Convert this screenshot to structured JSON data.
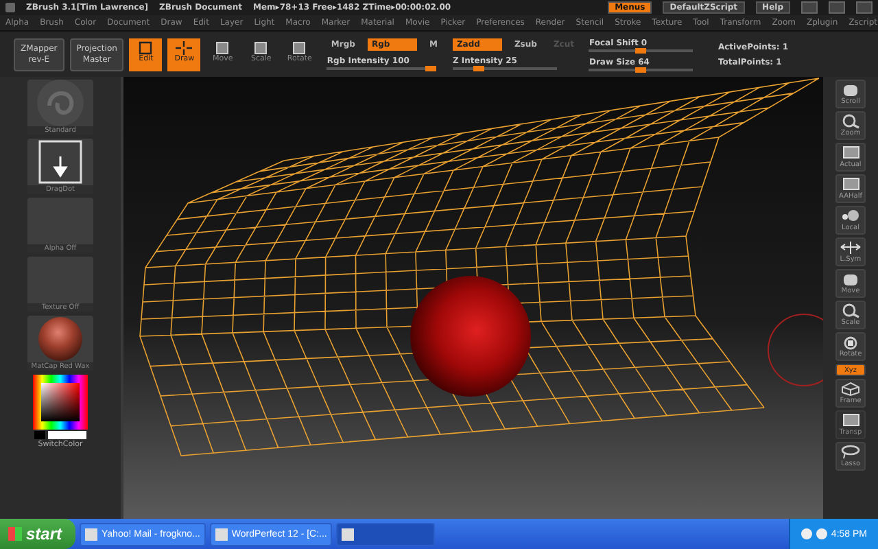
{
  "title_bar": {
    "app": "ZBrush 3.1[Tim Lawrence]",
    "document": "ZBrush Document",
    "stats": "Mem▸78+13 Free▸1482 ZTime▸00:00:02.00",
    "buttons": [
      {
        "label": "Menus",
        "selected": true
      },
      {
        "label": "DefaultZScript",
        "selected": false
      },
      {
        "label": "Help",
        "selected": false
      }
    ]
  },
  "menu": [
    "Alpha",
    "Brush",
    "Color",
    "Document",
    "Draw",
    "Edit",
    "Layer",
    "Light",
    "Macro",
    "Marker",
    "Material",
    "Movie",
    "Picker",
    "Preferences",
    "Render",
    "Stencil",
    "Stroke",
    "Texture",
    "Tool",
    "Transform",
    "Zoom",
    "Zplugin",
    "Zscript"
  ],
  "toolbar": {
    "plugins": [
      {
        "line1": "ZMapper",
        "line2": "rev-E"
      },
      {
        "line1": "Projection",
        "line2": "Master"
      }
    ],
    "modes": [
      {
        "label": "Edit",
        "kind": "edit",
        "selected": true
      },
      {
        "label": "Draw",
        "kind": "draw",
        "selected": true
      },
      {
        "label": "Move",
        "kind": "move",
        "selected": false
      },
      {
        "label": "Scale",
        "kind": "scale",
        "selected": false
      },
      {
        "label": "Rotate",
        "kind": "rotate",
        "selected": false
      }
    ],
    "color_modes": [
      {
        "label": "Mrgb",
        "selected": false
      },
      {
        "label": "Rgb",
        "selected": true
      },
      {
        "label": "M",
        "selected": false
      }
    ],
    "rgb_intensity": {
      "label": "Rgb Intensity 100",
      "level": 1
    },
    "depth_modes": [
      {
        "label": "Zadd",
        "selected": true,
        "disabled": false
      },
      {
        "label": "Zsub",
        "selected": false,
        "disabled": false
      },
      {
        "label": "Zcut",
        "selected": false,
        "disabled": true
      }
    ],
    "z_intensity": {
      "label": "Z Intensity 25",
      "level": 0.25
    },
    "focal_shift": {
      "label": "Focal Shift 0",
      "level": 0.5
    },
    "draw_size": {
      "label": "Draw Size 64",
      "level": 0.5
    },
    "stats": [
      "ActivePoints: 1",
      "TotalPoints: 1"
    ]
  },
  "left_shelf": {
    "items": [
      {
        "label": "Standard",
        "kind": "brush"
      },
      {
        "label": "DragDot",
        "kind": "stroke"
      },
      {
        "label": "Alpha Off",
        "kind": "empty"
      },
      {
        "label": "Texture Off",
        "kind": "empty"
      },
      {
        "label": "MatCap Red Wax",
        "kind": "material"
      }
    ],
    "color_label": "SwitchColor"
  },
  "right_shelf": [
    {
      "label": "Scroll",
      "kind": "hand",
      "selected": false,
      "disabled": false
    },
    {
      "label": "Zoom",
      "kind": "zoom",
      "selected": false,
      "disabled": false
    },
    {
      "label": "Actual",
      "kind": "frame",
      "selected": false,
      "disabled": false
    },
    {
      "label": "AAHalf",
      "kind": "frame",
      "selected": false,
      "disabled": false
    },
    {
      "label": "Local",
      "kind": "local",
      "selected": false,
      "disabled": false
    },
    {
      "label": "L.Sym",
      "kind": "sym",
      "selected": false,
      "disabled": false
    },
    {
      "label": "Move",
      "kind": "hand",
      "selected": false,
      "disabled": false
    },
    {
      "label": "Scale",
      "kind": "zoom",
      "selected": false,
      "disabled": false
    },
    {
      "label": "Rotate",
      "kind": "rotate",
      "selected": false,
      "disabled": false
    },
    {
      "label": "Xyz",
      "kind": "toggle",
      "selected": true,
      "disabled": false
    },
    {
      "label": "Frame",
      "kind": "cube",
      "selected": false,
      "disabled": false
    },
    {
      "label": "Transp",
      "kind": "frame",
      "selected": false,
      "disabled": true
    },
    {
      "label": "Lasso",
      "kind": "lasso",
      "selected": false,
      "disabled": false
    }
  ],
  "taskbar": {
    "start": "start",
    "tasks": [
      {
        "label": "Yahoo! Mail - frogkno...",
        "selected": false
      },
      {
        "label": "WordPerfect 12 - [C:...",
        "selected": false
      },
      {
        "selected": true
      }
    ],
    "clock": "4:58 PM"
  }
}
